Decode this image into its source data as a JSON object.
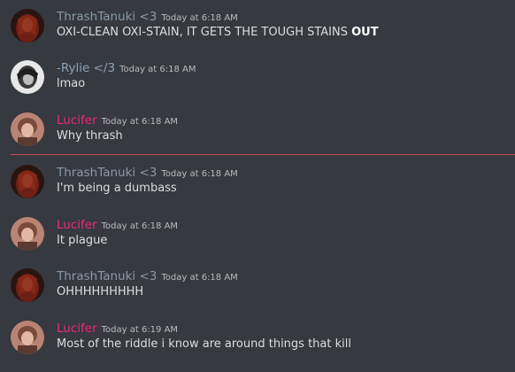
{
  "colors": {
    "background": "#36393f",
    "thrash_name": "#8a98a8",
    "rylie_name": "#8da0b3",
    "lucifer_name": "#e92b7a",
    "new_messages_divider": "#d9534f"
  },
  "messages": [
    {
      "author": "ThrashTanuki <3",
      "author_key": "thrash",
      "timestamp": "Today at 6:18 AM",
      "text": "OXI-CLEAN OXI-STAIN, IT GETS THE TOUGH STAINS ",
      "text_bold": "OUT",
      "avatar_icon": "thrash-avatar-icon"
    },
    {
      "author": "-Rylie </3",
      "author_key": "rylie",
      "timestamp": "Today at 6:18 AM",
      "text": "lmao",
      "avatar_icon": "rylie-avatar-icon"
    },
    {
      "author": "Lucifer",
      "author_key": "lucifer",
      "timestamp": "Today at 6:18 AM",
      "text": "Why thrash",
      "avatar_icon": "lucifer-avatar-icon"
    },
    {
      "author": "ThrashTanuki <3",
      "author_key": "thrash",
      "timestamp": "Today at 6:18 AM",
      "text": "I'm being a dumbass",
      "avatar_icon": "thrash-avatar-icon"
    },
    {
      "author": "Lucifer",
      "author_key": "lucifer",
      "timestamp": "Today at 6:18 AM",
      "text": "It plague",
      "avatar_icon": "lucifer-avatar-icon"
    },
    {
      "author": "ThrashTanuki <3",
      "author_key": "thrash",
      "timestamp": "Today at 6:18 AM",
      "text": "OHHHHHHHHH",
      "avatar_icon": "thrash-avatar-icon"
    },
    {
      "author": "Lucifer",
      "author_key": "lucifer",
      "timestamp": "Today at 6:19 AM",
      "text": "Most of the riddle i know are around things that kill",
      "avatar_icon": "lucifer-avatar-icon"
    }
  ]
}
